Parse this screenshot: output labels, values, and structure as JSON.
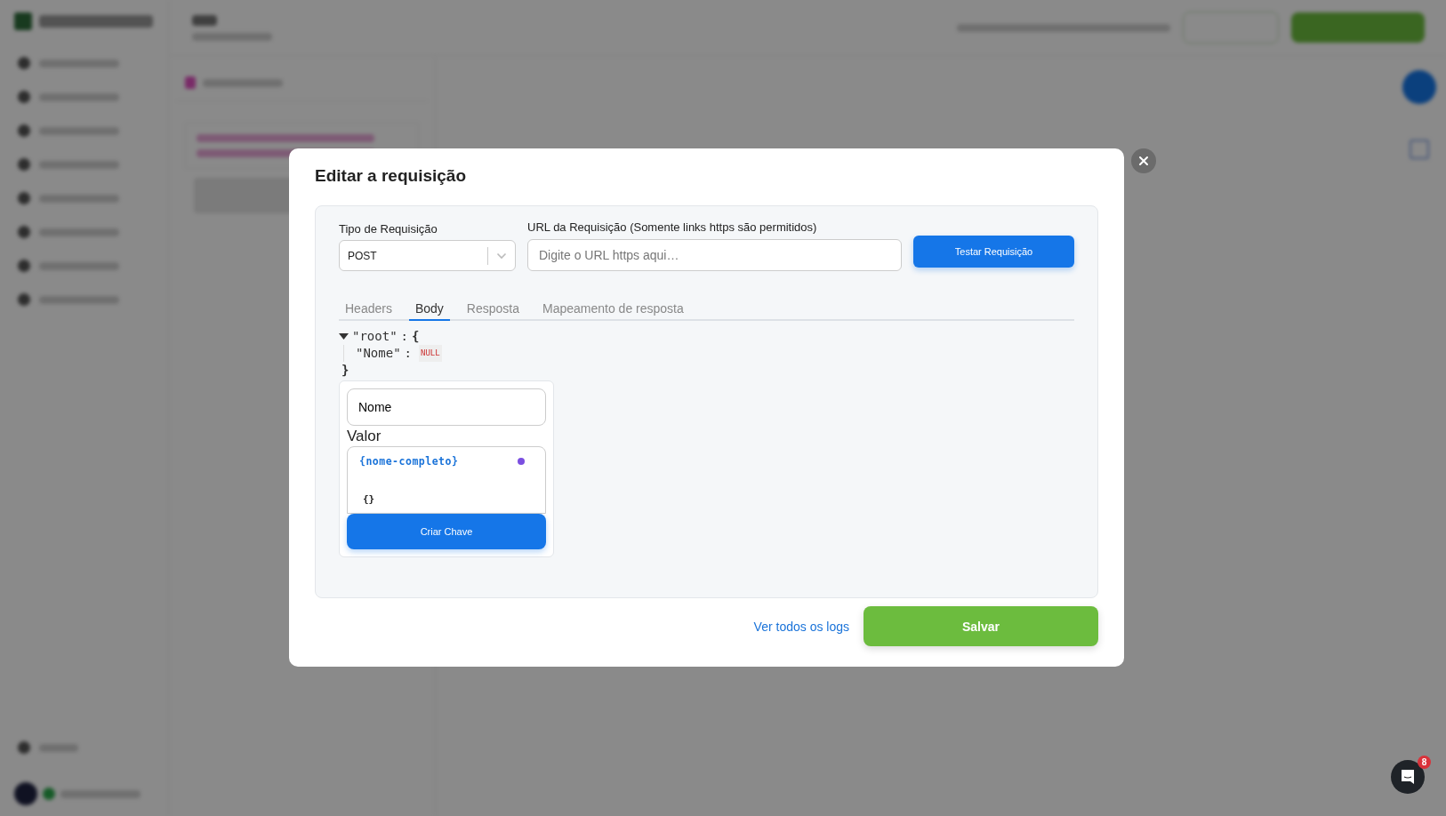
{
  "chat_launcher": {
    "badge": "8"
  },
  "modal": {
    "title": "Editar a requisição",
    "request_type": {
      "label": "Tipo de Requisição",
      "value": "POST"
    },
    "url": {
      "label": "URL da Requisição (Somente links https são permitidos)",
      "placeholder": "Digite o URL https aqui…"
    },
    "test_button": "Testar Requisição",
    "tabs": [
      {
        "label": "Headers",
        "selected": false
      },
      {
        "label": "Body",
        "selected": true
      },
      {
        "label": "Resposta",
        "selected": false
      },
      {
        "label": "Mapeamento de resposta",
        "selected": false
      }
    ],
    "body_tree": {
      "key": "\"root\"",
      "colon": ":",
      "open": "{",
      "close": "}",
      "expanded": true,
      "children": [
        {
          "key": "\"Nome\"",
          "colon": ":",
          "value": "NULL"
        }
      ]
    },
    "key_form": {
      "key_value": "Nome",
      "value_label": "Valor",
      "variable": "{nome-completo}",
      "braces": "{}",
      "create_button": "Criar Chave"
    },
    "footer": {
      "logs_link": "Ver todos os logs",
      "save_button": "Salvar"
    }
  }
}
